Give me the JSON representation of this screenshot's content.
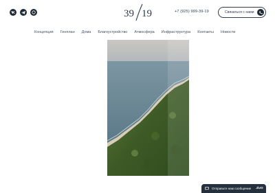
{
  "header": {
    "socials": [
      {
        "icon": "vk-icon"
      },
      {
        "icon": "telegram-icon"
      },
      {
        "icon": "whatsapp-icon"
      }
    ],
    "logo_text": "39/19",
    "phone": "+7 (925) 999-39-19",
    "contact_button_label": "Связаться с нами"
  },
  "nav": {
    "items": [
      {
        "label": "Концепция"
      },
      {
        "label": "Генплан"
      },
      {
        "label": "Дома"
      },
      {
        "label": "Благоустройство"
      },
      {
        "label": "Атмосфера"
      },
      {
        "label": "Инфраструктура"
      },
      {
        "label": "Контакты"
      },
      {
        "label": "Новости"
      }
    ]
  },
  "hero": {
    "image": "aerial-coastline-photo"
  },
  "chat_widget": {
    "label": "Отправьте нам сообщение",
    "brand": "JivO"
  },
  "colors": {
    "dark": "#1f2a36",
    "text": "#2b3a4a",
    "chat_bg": "#24303d"
  }
}
